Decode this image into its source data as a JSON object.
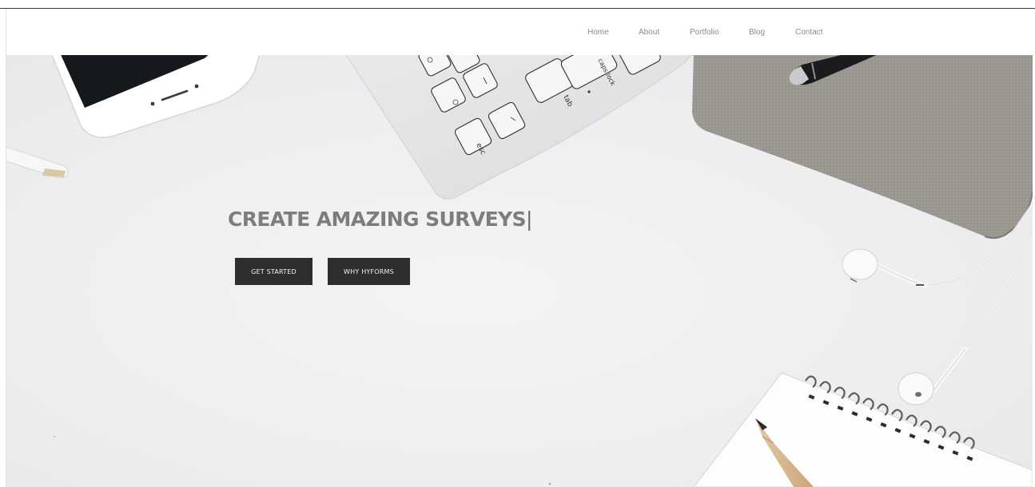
{
  "nav": {
    "items": [
      {
        "label": "Home"
      },
      {
        "label": "About"
      },
      {
        "label": "Portfolio"
      },
      {
        "label": "Blog"
      },
      {
        "label": "Contact"
      }
    ]
  },
  "hero": {
    "headline": "CREATE AMAZING SURVEYS",
    "cursor": "|",
    "buttons": {
      "get_started": "GET STARTED",
      "why_hyforms": "WHY HYFORMS"
    },
    "keyboard_keys": {
      "esc": "esc",
      "tab": "tab",
      "caps_lock": "caps lock"
    }
  },
  "colors": {
    "button_bg": "#2e2e2e",
    "button_text": "#f2f2f2",
    "headline": "#7d7d7d",
    "nav_text": "#8a8a8a",
    "desk_bg": "#eeeef0"
  },
  "icons": [
    "phone-image",
    "keyboard-image",
    "notebook-image",
    "pen-image",
    "earbuds-image",
    "spiral-notepad-image",
    "pencil-image"
  ]
}
